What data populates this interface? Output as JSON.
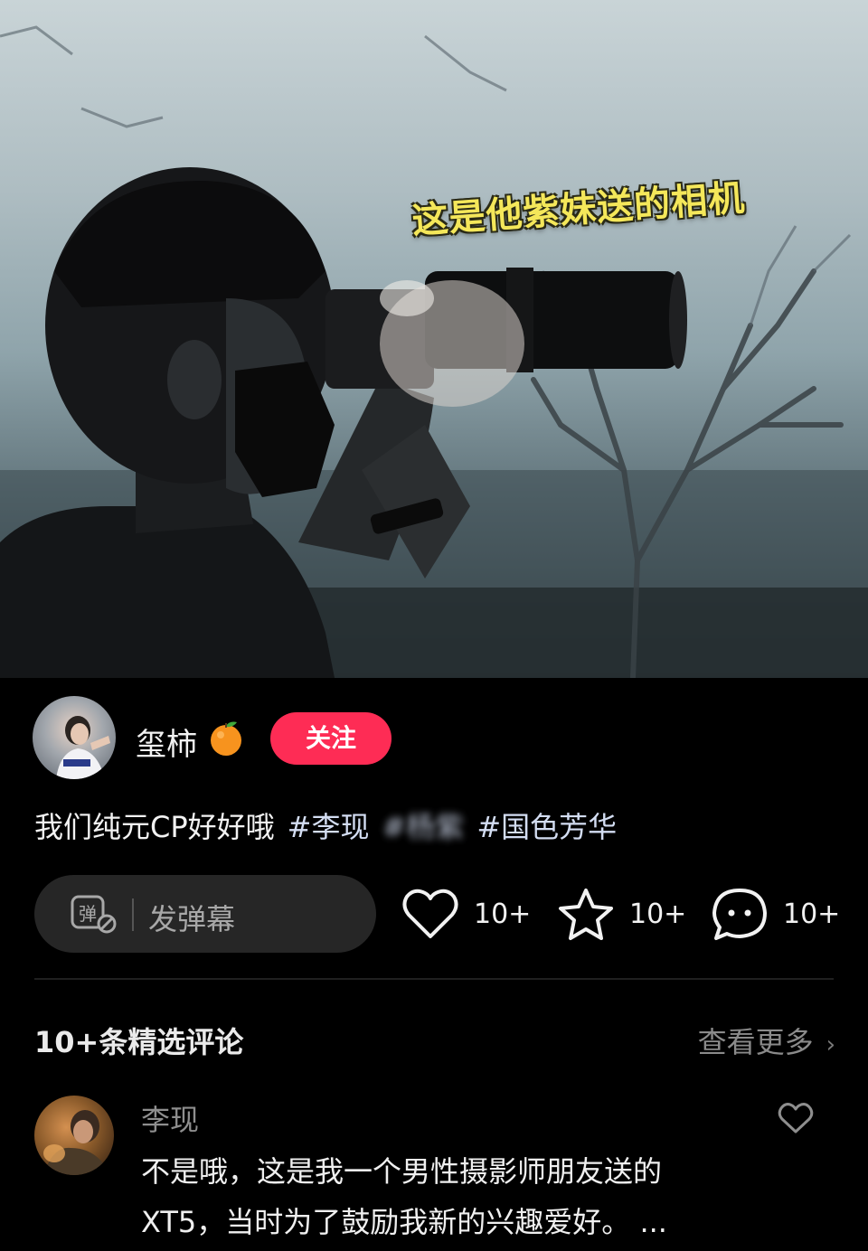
{
  "video": {
    "overlay_caption": "这是他紫妹送的相机"
  },
  "author": {
    "name": "玺柿",
    "badge_icon": "orange-emoji",
    "follow_label": "关注"
  },
  "post": {
    "text": "我们纯元CP好好哦",
    "tags": [
      "#李现",
      "#杨紫",
      "#国色芳华"
    ]
  },
  "actions": {
    "danmaku_placeholder": "发弹幕",
    "danmaku_icon_text": "弹",
    "like_count": "10+",
    "favorite_count": "10+",
    "comment_count": "10+"
  },
  "comments": {
    "header": "10+条精选评论",
    "see_more": "查看更多",
    "items": [
      {
        "user": "李现",
        "text": "不是哦，这是我一个男性摄影师朋友送的XT5，当时为了鼓励我新的兴趣爱好。 ..."
      }
    ]
  },
  "colors": {
    "accent": "#fe2c55",
    "caption_yellow": "#f4e75a",
    "background": "#000000"
  }
}
